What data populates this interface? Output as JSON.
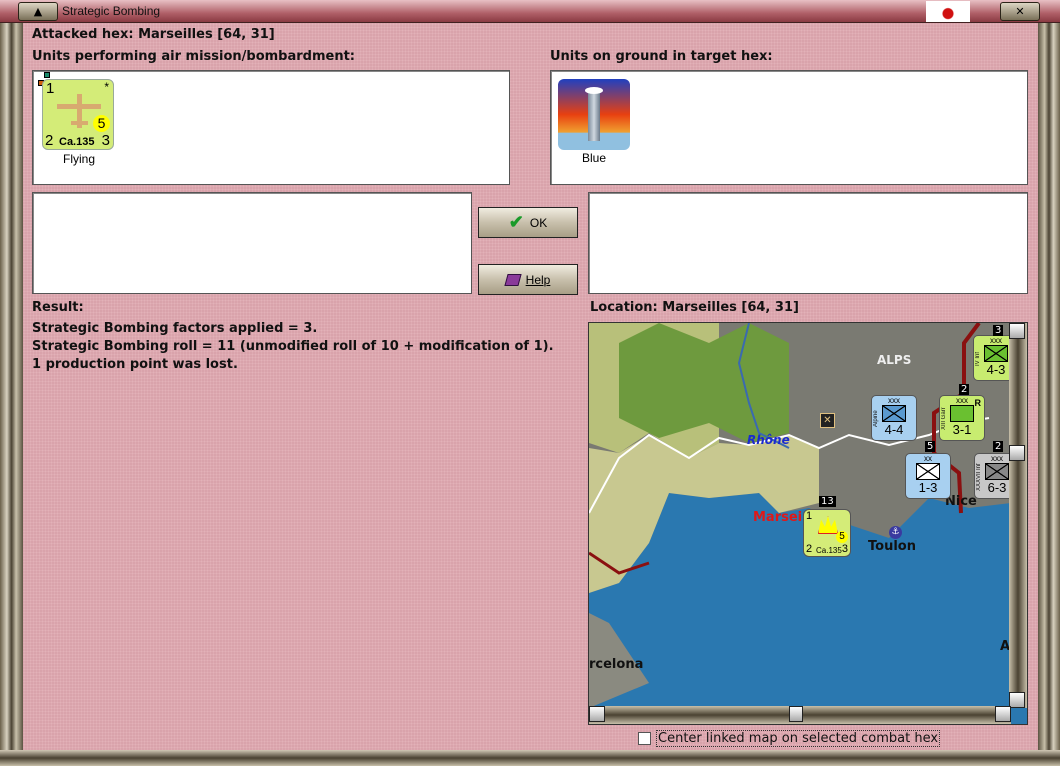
{
  "window": {
    "title": "Strategic Bombing"
  },
  "header": {
    "attacked_hex": "Attacked hex: Marseilles  [64, 31]"
  },
  "attackers": {
    "label": "Units performing air mission/bombardment:",
    "units": [
      {
        "name": "Ca.135",
        "top_left": "1",
        "star": "*",
        "bombing": "5",
        "bottom_left": "2",
        "bottom_right": "3",
        "status": "Flying"
      }
    ]
  },
  "defenders": {
    "label": "Units on ground in target hex:",
    "units": [
      {
        "name": "Blue"
      }
    ]
  },
  "buttons": {
    "ok": "OK",
    "help": "Help"
  },
  "result": {
    "label": "Result:",
    "lines": [
      "Strategic Bombing factors applied = 3.",
      "Strategic Bombing roll = 11 (unmodified roll of 10 + modification of 1).",
      "1 production point was lost."
    ]
  },
  "location": {
    "label": "Location:  Marseilles  [64, 31]"
  },
  "map": {
    "labels": {
      "alps": "ALPS",
      "rhone": "Rhône",
      "marseilles": "Marsei",
      "toulon": "Toulon",
      "nice": "Nice",
      "barcelona": "rcelona",
      "edge_a": "A"
    },
    "units": [
      {
        "type": "xxx",
        "name": "IV Inf",
        "value": "4-3",
        "stack": "3"
      },
      {
        "type": "xxx",
        "name": "Alpine",
        "value": "4-4"
      },
      {
        "type": "xxx",
        "name": "XIII Garr",
        "value": "3-1",
        "stack": "2",
        "flag": "R"
      },
      {
        "type": "xx",
        "name": "",
        "value": "1-3",
        "stack": "5"
      },
      {
        "type": "xxx",
        "name": "XXXVII Inf",
        "value": "6-3",
        "stack": "2"
      }
    ],
    "air_stack": "13"
  },
  "options": {
    "center_map": "Center linked map on selected combat hex",
    "center_map_checked": false
  },
  "colors": {
    "background": "#d9a3ab",
    "sea": "#2a78b0"
  }
}
